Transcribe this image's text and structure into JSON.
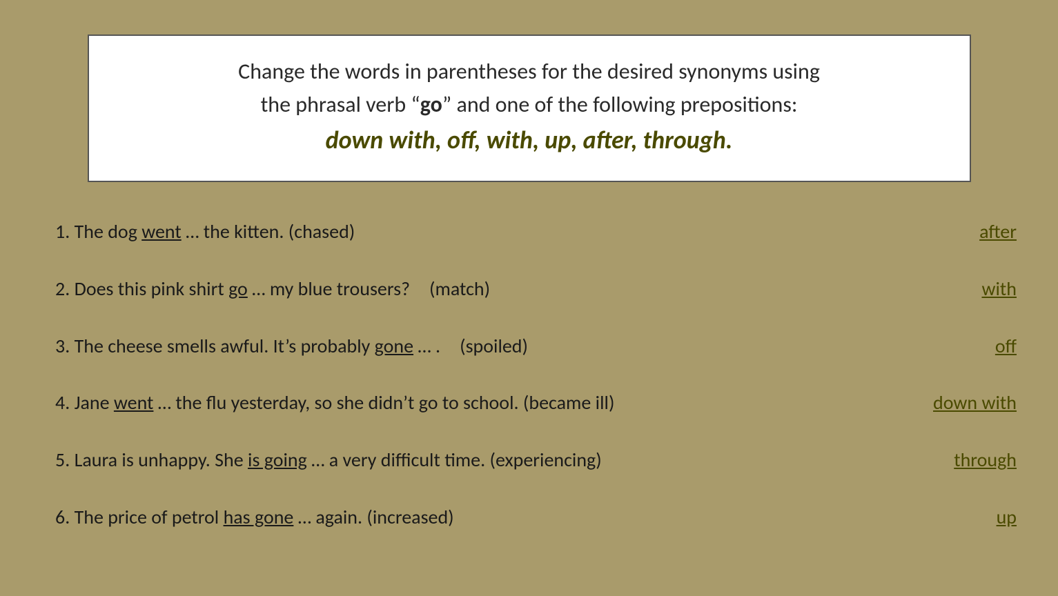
{
  "instruction": {
    "line1": "Change the words in parentheses for the desired synonyms using",
    "line2_pre": "the phrasal verb “",
    "line2_go": "go",
    "line2_post": "” and one of the following prepositions:",
    "prepositions": "down with,  off,  with,  up,  after,  through."
  },
  "exercises": [
    {
      "number": "1.",
      "text_parts": [
        {
          "text": "The dog ",
          "underline": false
        },
        {
          "text": "went",
          "underline": true
        },
        {
          "text": " … the kitten. (chased)",
          "underline": false
        }
      ],
      "answer": "after"
    },
    {
      "number": "2.",
      "text_parts": [
        {
          "text": "Does this pink shirt ",
          "underline": false
        },
        {
          "text": "go",
          "underline": true
        },
        {
          "text": " … my blue trousers? (match)",
          "underline": false
        }
      ],
      "answer": "with"
    },
    {
      "number": "3.",
      "text_parts": [
        {
          "text": "The cheese smells awful. It’s probably ",
          "underline": false
        },
        {
          "text": "gone",
          "underline": true
        },
        {
          "text": " … . (spoiled)",
          "underline": false
        }
      ],
      "answer": "off"
    },
    {
      "number": "4.",
      "text_parts": [
        {
          "text": "Jane ",
          "underline": false
        },
        {
          "text": "went",
          "underline": true
        },
        {
          "text": " … the flu yesterday, so she didn’t go to school. (became ill)",
          "underline": false
        }
      ],
      "answer": "down with"
    },
    {
      "number": "5.",
      "text_parts": [
        {
          "text": "Laura is unhappy. She ",
          "underline": false
        },
        {
          "text": "is going",
          "underline": true
        },
        {
          "text": " … a very difficult time. (experiencing)",
          "underline": false
        }
      ],
      "answer": "through"
    },
    {
      "number": "6.",
      "text_parts": [
        {
          "text": "The price of petrol ",
          "underline": false
        },
        {
          "text": "has gone",
          "underline": true
        },
        {
          "text": " … again. (increased)",
          "underline": false
        }
      ],
      "answer": "up"
    }
  ]
}
